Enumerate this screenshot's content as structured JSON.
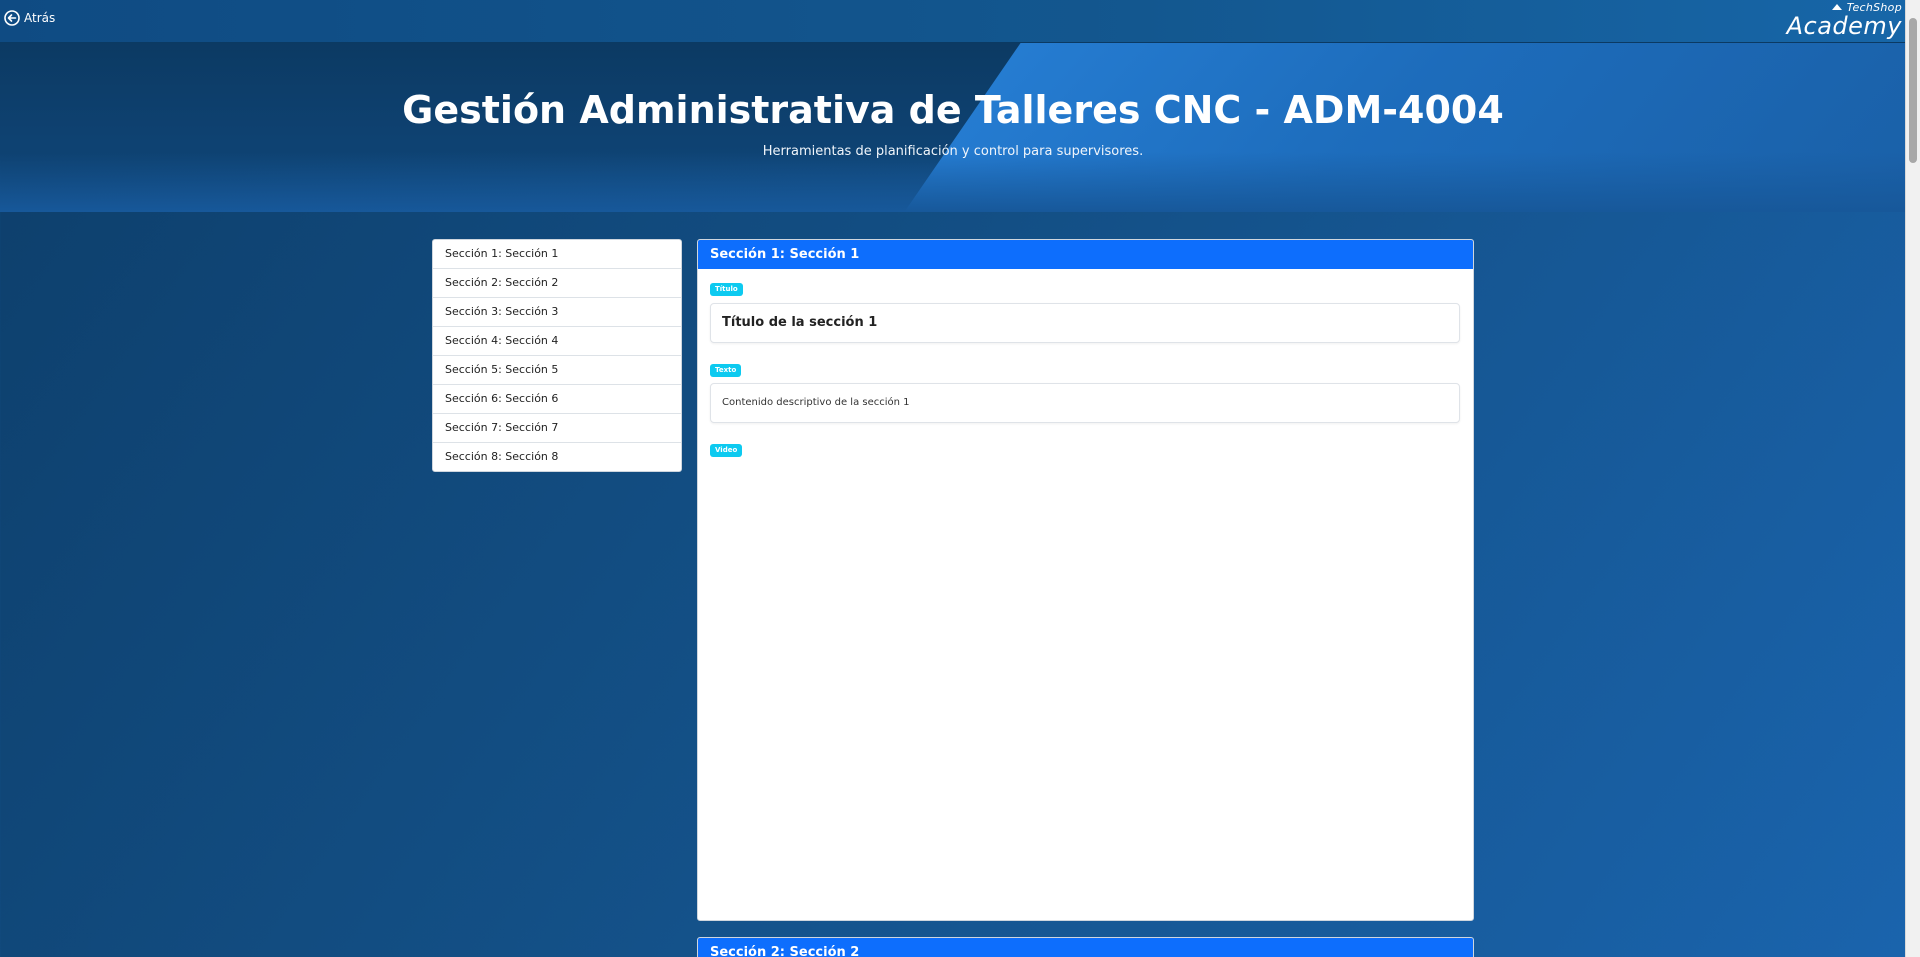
{
  "topbar": {
    "back_label": "Atrás",
    "logo_top": "TechShop",
    "logo_main": "Academy"
  },
  "hero": {
    "title": "Gestión Administrativa de Talleres CNC - ADM-4004",
    "subtitle": "Herramientas de planificación y control para supervisores."
  },
  "sidebar": {
    "items": [
      {
        "label": "Sección 1: Sección 1"
      },
      {
        "label": "Sección 2: Sección 2"
      },
      {
        "label": "Sección 3: Sección 3"
      },
      {
        "label": "Sección 4: Sección 4"
      },
      {
        "label": "Sección 5: Sección 5"
      },
      {
        "label": "Sección 6: Sección 6"
      },
      {
        "label": "Sección 7: Sección 7"
      },
      {
        "label": "Sección 8: Sección 8"
      }
    ]
  },
  "sections": [
    {
      "header": "Sección 1: Sección 1",
      "title_badge": "Título",
      "title_text": "Título de la sección 1",
      "text_badge": "Texto",
      "text_content": "Contenido descriptivo de la sección 1",
      "video_badge": "Video"
    },
    {
      "header": "Sección 2: Sección 2"
    }
  ],
  "colors": {
    "header_blue": "#0d6efd",
    "badge_cyan": "#0dcaf0",
    "page_bg": "#134f85"
  }
}
